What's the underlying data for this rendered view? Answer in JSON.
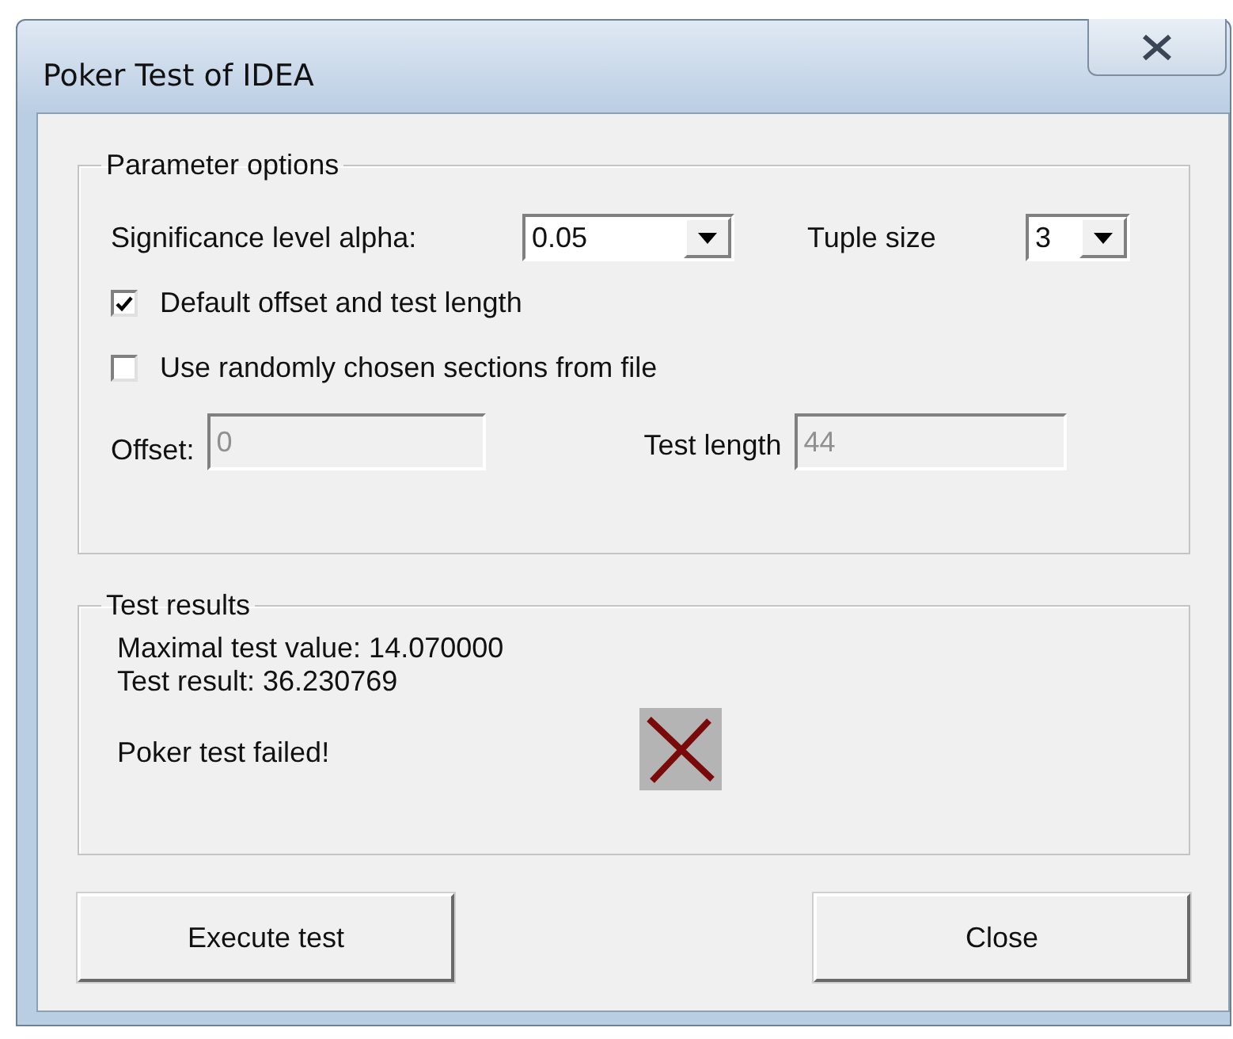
{
  "window": {
    "title": "Poker Test of IDEA"
  },
  "parameters": {
    "title": "Parameter options",
    "alpha": {
      "label": "Significance level alpha:",
      "value": "0.05"
    },
    "tuple": {
      "label": "Tuple size",
      "value": "3"
    },
    "checkboxes": [
      {
        "label": "Default offset and test length",
        "checked": true
      },
      {
        "label": "Use randomly chosen sections from file",
        "checked": false
      }
    ],
    "offset": {
      "label": "Offset:",
      "value": "0",
      "disabled": true
    },
    "length": {
      "label": "Test length",
      "value": "44",
      "disabled": true
    }
  },
  "results": {
    "title": "Test results",
    "lines": [
      "Maximal test value: 14.070000",
      "Test result: 36.230769"
    ],
    "verdict": "Poker test failed!",
    "passed": false
  },
  "buttons": [
    "Execute test",
    "Close"
  ]
}
